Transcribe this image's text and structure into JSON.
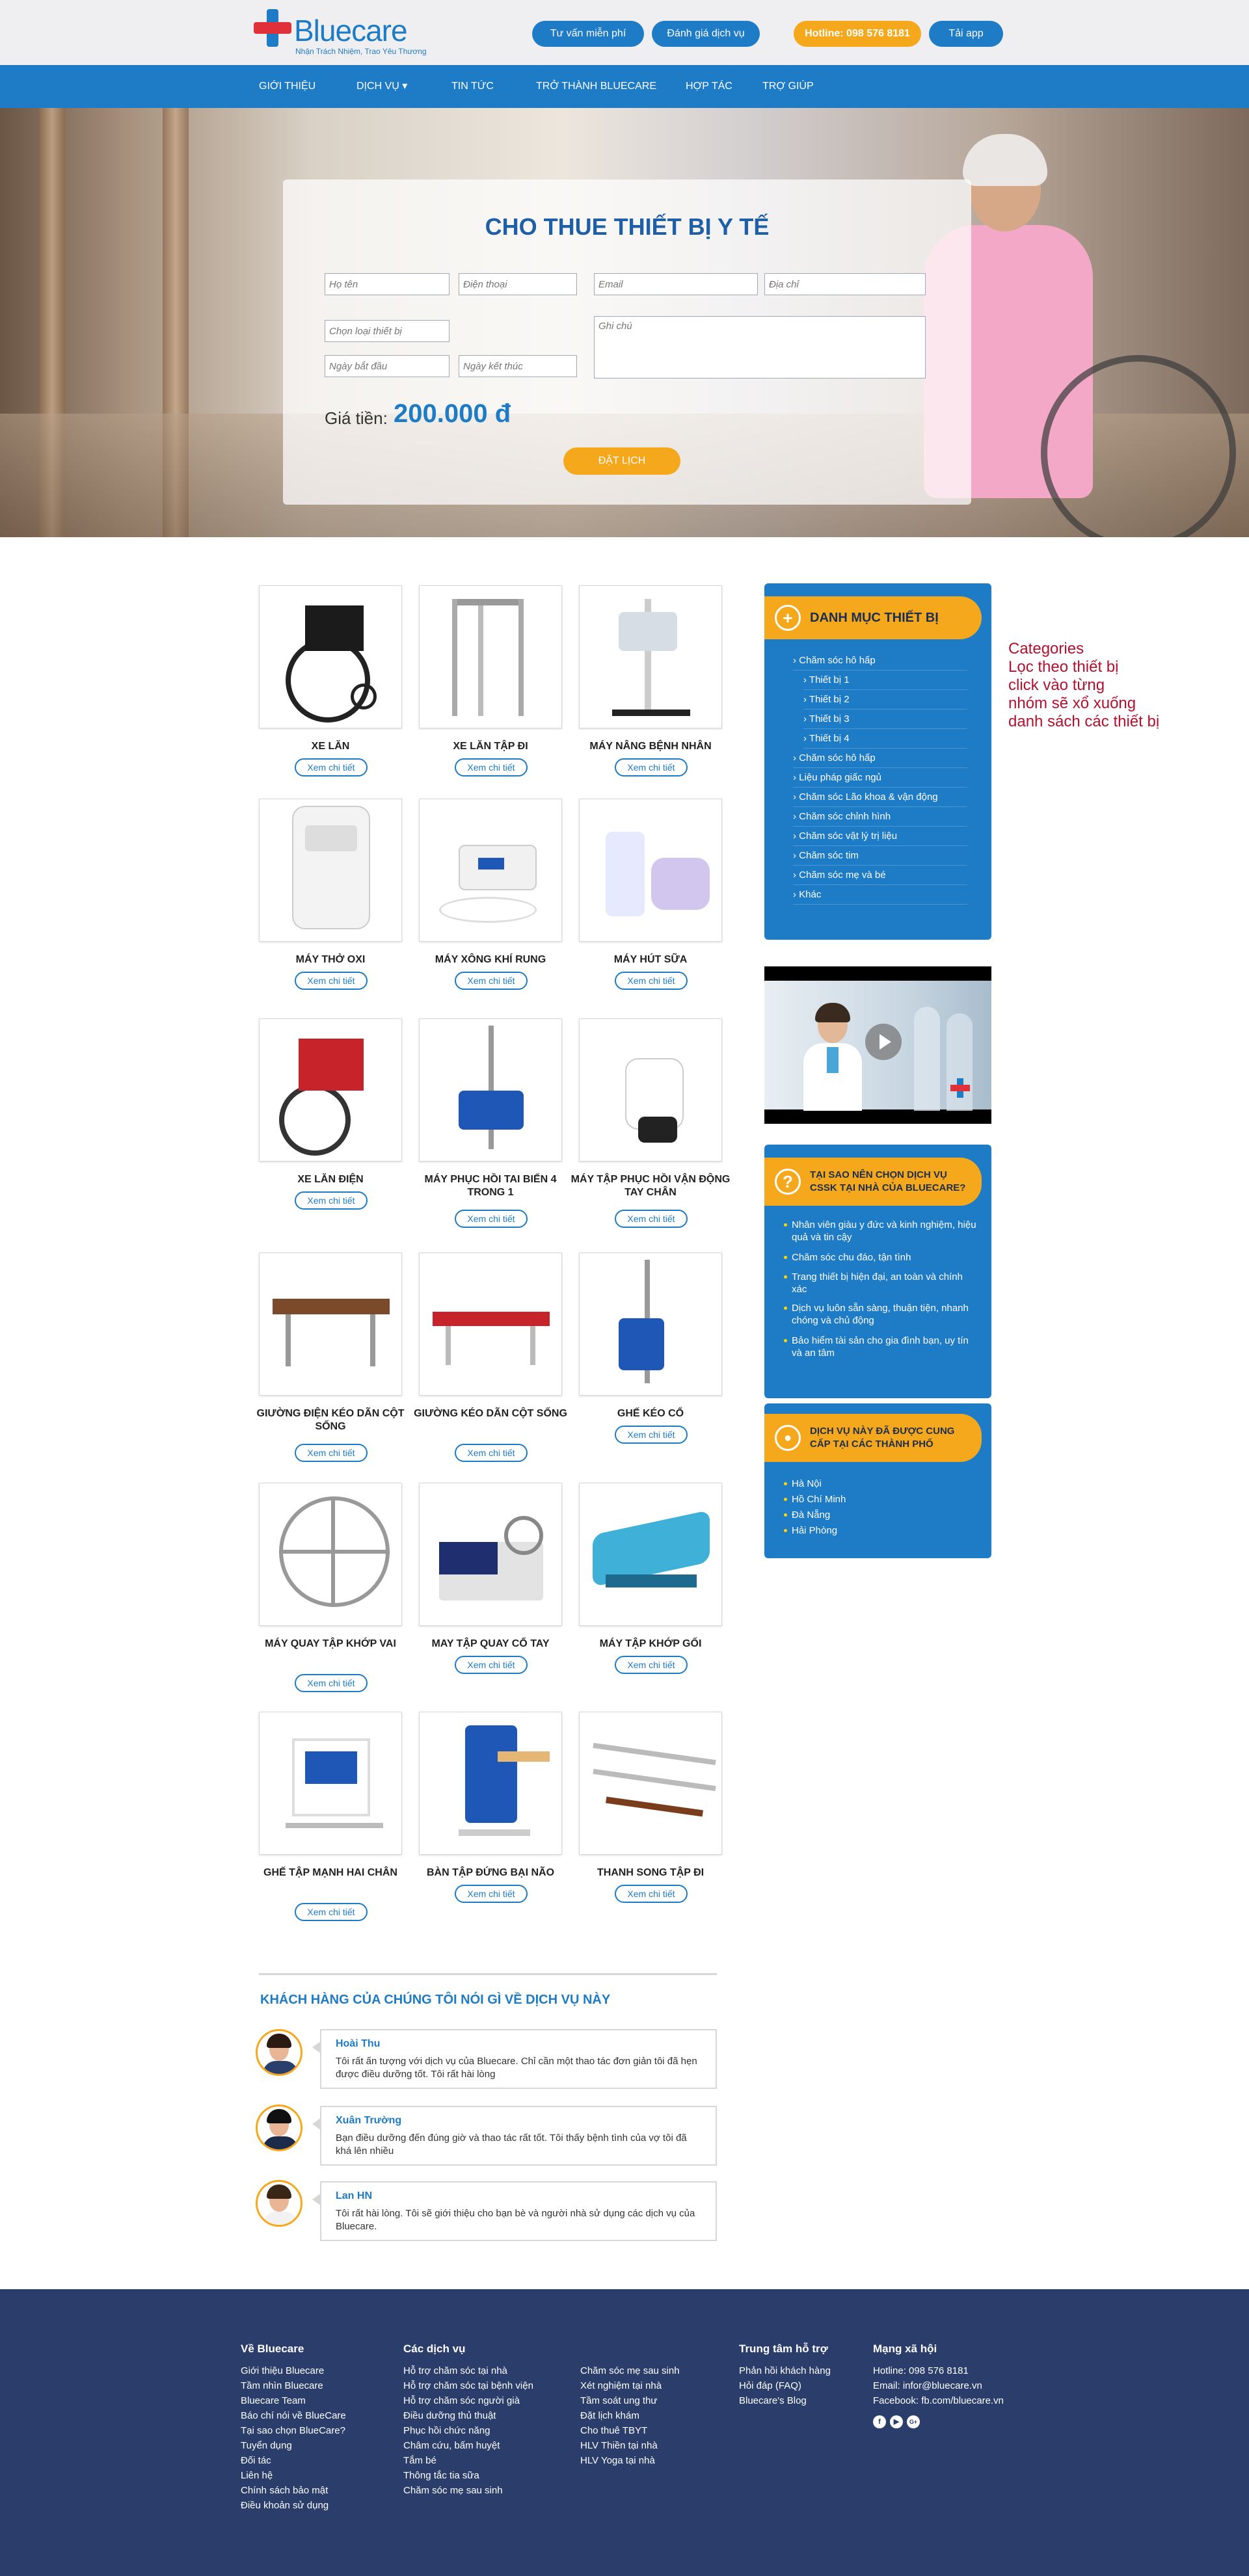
{
  "header": {
    "logo_text": "Bluecare",
    "logo_slogan": "Nhận Trách Nhiệm, Trao Yêu Thương",
    "btn_consult": "Tư vấn miễn phí",
    "btn_review": "Đánh giá dịch vụ",
    "hotline": "Hotline: 098 576 8181",
    "btn_app": "Tải app",
    "accent": "#1e7bc6",
    "orange": "#f6a81c"
  },
  "nav": [
    "GIỚI THIỆU",
    "DỊCH VỤ ▾",
    "TIN TỨC",
    "TRỞ THÀNH BLUECARE",
    "HỢP TÁC",
    "TRỢ GIÚP"
  ],
  "hero": {
    "title": "CHO THUE THIẾT BỊ Y TẾ",
    "placeholders": {
      "name": "Họ tên",
      "phone": "Điện thoại",
      "email": "Email",
      "address": "Địa chỉ",
      "device": "Chọn loại thiết bị",
      "note": "Ghi chú",
      "start": "Ngày bắt đầu",
      "end": "Ngày kết thúc"
    },
    "price_label": "Giá tiền:",
    "price_value": "200.000 đ",
    "book_button": "ĐẶT LỊCH"
  },
  "detail_label": "Xem chi tiết",
  "products": [
    {
      "name": "XE LĂN",
      "icon": "wheelchair"
    },
    {
      "name": "XE LĂN TẬP ĐI",
      "icon": "walker"
    },
    {
      "name": "MÁY NÂNG BỆNH NHÂN",
      "icon": "patient-lift"
    },
    {
      "name": "MÁY THỞ OXI",
      "icon": "oxygen-concentrator"
    },
    {
      "name": "MÁY XÔNG KHÍ RUNG",
      "icon": "nebulizer"
    },
    {
      "name": "MÁY HÚT SỮA",
      "icon": "breast-pump"
    },
    {
      "name": "XE LĂN ĐIỆN",
      "icon": "electric-wheelchair"
    },
    {
      "name": "MÁY PHỤC HỒI TAI BIẾN 4 TRONG 1",
      "icon": "rehab-machine"
    },
    {
      "name": "MÁY TẬP PHỤC HỒI VẬN ĐỘNG TAY CHÂN",
      "icon": "arm-leg-trainer"
    },
    {
      "name": "GIƯỜNG ĐIỆN KÉO DÃN CỘT SỐNG",
      "icon": "traction-bed"
    },
    {
      "name": "GIƯỜNG KÉO DÃN CỘT SỐNG",
      "icon": "traction-table"
    },
    {
      "name": "GHẾ KÉO CỔ",
      "icon": "neck-traction-chair"
    },
    {
      "name": "MÁY QUAY TẬP KHỚP VAI",
      "icon": "shoulder-wheel"
    },
    {
      "name": "MAY TẬP QUAY CỔ TAY",
      "icon": "wrist-trainer"
    },
    {
      "name": "MÁY TẬP KHỚP GỐI",
      "icon": "knee-cpm"
    },
    {
      "name": "GHẾ TẬP MẠNH HAI CHÂN",
      "icon": "leg-chair"
    },
    {
      "name": "BÀN TẬP ĐỨNG BẠI NÃO",
      "icon": "standing-frame"
    },
    {
      "name": "THANH SONG TẬP ĐI",
      "icon": "parallel-bars"
    }
  ],
  "sidebar": {
    "categories_title": "DANH MỤC THIẾT BỊ",
    "categories": [
      {
        "label": "Chăm sóc hô hấp",
        "level": 0
      },
      {
        "label": "Thiết bị 1",
        "level": 1
      },
      {
        "label": "Thiết bị 2",
        "level": 1
      },
      {
        "label": "Thiết bị 3",
        "level": 1
      },
      {
        "label": "Thiết bị 4",
        "level": 1
      },
      {
        "label": "Chăm sóc hô hấp",
        "level": 0
      },
      {
        "label": "Liệu pháp giấc ngủ",
        "level": 0
      },
      {
        "label": "Chăm sóc Lão khoa & vận động",
        "level": 0
      },
      {
        "label": "Chăm sóc chỉnh hình",
        "level": 0
      },
      {
        "label": "Chăm sóc vật lý trị liệu",
        "level": 0
      },
      {
        "label": "Chăm sóc tim",
        "level": 0
      },
      {
        "label": "Chăm sóc mẹ và bé",
        "level": 0
      },
      {
        "label": "Khác",
        "level": 0
      }
    ],
    "why_title": "TẠI SAO NÊN CHỌN DỊCH VỤ CSSK TẠI NHÀ CỦA BLUECARE?",
    "why_items": [
      "Nhân viên giàu y đức và kinh nghiệm, hiệu quả và tin cậy",
      "Chăm sóc chu đáo, tận tình",
      "Trang thiết bị hiện đại, an toàn và chính xác",
      "Dịch vụ luôn sẵn sàng, thuận tiện, nhanh chóng và chủ động",
      "Bảo hiểm tài sản cho gia đình bạn, uy tín và an tâm"
    ],
    "cities_title": "DỊCH VỤ NÀY ĐÃ ĐƯỢC CUNG CẤP TẠI CÁC THÀNH PHỐ",
    "cities": [
      "Hà Nội",
      "Hồ Chí Minh",
      "Đà Nẵng",
      "Hải Phòng"
    ]
  },
  "annotation": "Categories\nLọc theo thiết bị\nclick vào từng\nnhóm sẽ xổ xuống\ndanh sách các thiết bị",
  "testimonials": {
    "title": "KHÁCH HÀNG CỦA CHÚNG TÔI NÓI GÌ VỀ DỊCH VỤ NÀY",
    "items": [
      {
        "name": "Hoài Thu",
        "text": "Tôi rất ấn tượng với dịch vụ của Bluecare. Chỉ cần một thao tác đơn giản tôi đã hẹn được điều dưỡng tốt. Tôi rất hài lòng"
      },
      {
        "name": "Xuân Trường",
        "text": "Bạn điều dưỡng đến đúng giờ và thao tác rất tốt. Tôi thấy bệnh tình của vợ tôi đã khá lên nhiều"
      },
      {
        "name": "Lan HN",
        "text": "Tôi rất hài lòng. Tôi sẽ giới thiệu cho bạn bè và người nhà sử dụng các dịch vụ của Bluecare."
      }
    ]
  },
  "footer": {
    "about": {
      "title": "Về Bluecare",
      "links": [
        "Giới thiệu Bluecare",
        "Tầm nhìn Bluecare",
        "Bluecare Team",
        "Báo chí nói về BlueCare",
        "Tại sao chọn BlueCare?",
        "Tuyển dụng",
        "Đối tác",
        "Liên hệ",
        "Chính sách bảo mật",
        "Điều khoản sử dụng"
      ]
    },
    "services": {
      "title": "Các dịch vụ",
      "links_a": [
        "Hỗ trợ chăm sóc tại nhà",
        "Hỗ trợ chăm sóc tại bệnh viện",
        "Hỗ trợ chăm sóc người già",
        "Điều dưỡng thủ thuật",
        "Phục hồi chức năng",
        "Châm cứu, bấm huyệt",
        "Tắm bé",
        "Thông tắc tia sữa",
        "Chăm sóc mẹ sau sinh"
      ],
      "links_b": [
        "Chăm sóc mẹ sau sinh",
        "Xét nghiệm tại nhà",
        "Tầm soát ung thư",
        "Đặt lịch khám",
        "Cho thuê TBYT",
        "HLV Thiền tại nhà",
        "HLV Yoga tại nhà"
      ]
    },
    "support": {
      "title": "Trung tâm hỗ trợ",
      "links": [
        "Phản hồi khách hàng",
        "Hỏi đáp (FAQ)",
        "Bluecare's Blog"
      ]
    },
    "social": {
      "title": "Mạng xã hội",
      "links": [
        "Hotline: 098 576 8181",
        "Email: infor@bluecare.vn",
        "Facebook: fb.com/bluecare.vn"
      ],
      "icons": [
        "f",
        "▶",
        "G+"
      ]
    }
  }
}
